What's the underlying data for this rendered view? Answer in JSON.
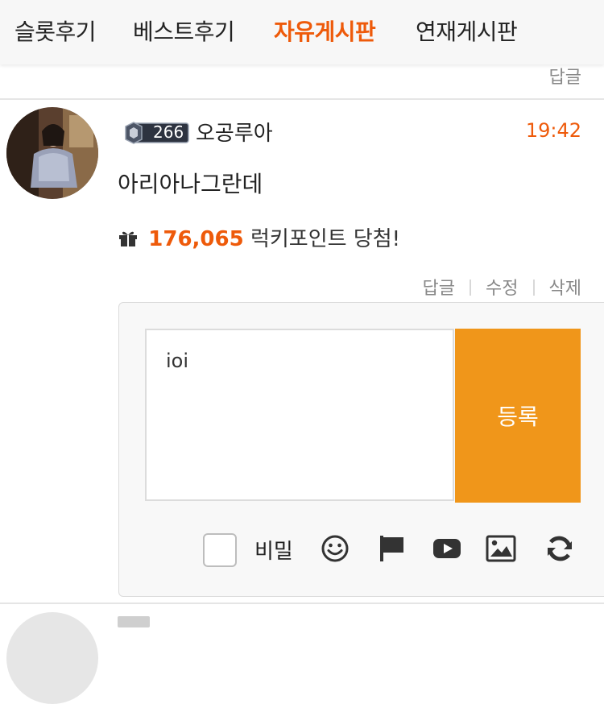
{
  "tabs": [
    "슬롯후기",
    "베스트후기",
    "자유게시판",
    "연재게시판"
  ],
  "active_tab": "자유게시판",
  "top_reply_label": "답글",
  "comment": {
    "level": "266",
    "username": "오공루아",
    "time": "19:42",
    "text": "아리아나그란데",
    "prize_points": "176,065",
    "prize_text": "럭키포인트 당첨!",
    "actions": [
      "답글",
      "수정",
      "삭제"
    ]
  },
  "reply_form": {
    "input_value": "ioi",
    "submit_label": "등록",
    "secret_label": "비밀",
    "secret_checked": false,
    "icons": [
      "smile-icon",
      "flag-icon",
      "youtube-icon",
      "image-icon",
      "refresh-icon"
    ]
  },
  "colors": {
    "accent": "#ee5a0a",
    "submit": "#f0961a"
  }
}
